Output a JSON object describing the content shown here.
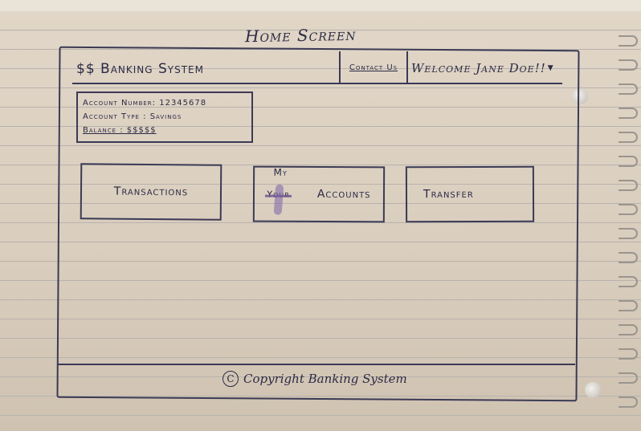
{
  "page_title": "Home Screen",
  "header": {
    "logo": "$$ Banking System",
    "contact_link": "Contact Us",
    "welcome": "Welcome Jane Doe!!"
  },
  "account": {
    "number_line": "Account Number: 12345678",
    "type_line": "Account Type : Savings",
    "balance_line": "Balance : $$$$$"
  },
  "buttons": {
    "transactions": "Transactions",
    "my_accounts_prefix": "My",
    "my_accounts_struck": "Your",
    "my_accounts_word": "Accounts",
    "transfer": "Transfer"
  },
  "footer": {
    "copyright_symbol": "C",
    "copyright_text": "Copyright Banking System"
  }
}
